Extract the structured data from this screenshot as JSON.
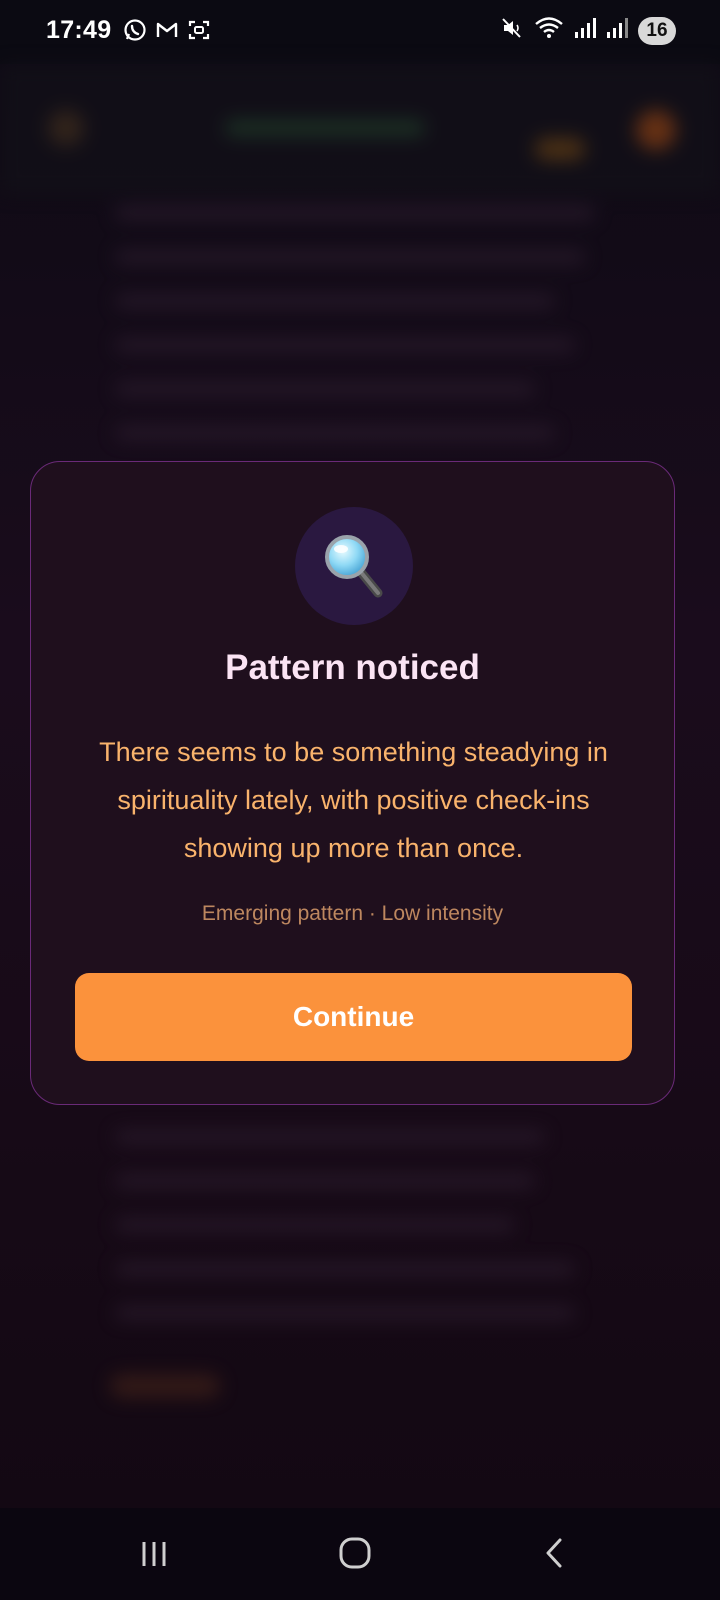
{
  "status_bar": {
    "time": "17:49",
    "left_icons": [
      "whatsapp-icon",
      "gmail-icon",
      "screenshot-icon"
    ],
    "right_icons": [
      "mute-icon",
      "wifi-icon",
      "signal-icon",
      "signal-icon-2"
    ],
    "battery": "16"
  },
  "modal": {
    "icon": "magnifying-glass-icon",
    "title": "Pattern noticed",
    "message": "There seems to be something steadying in spirituality lately, with positive check-ins showing up more than once.",
    "meta": "Emerging pattern · Low intensity",
    "continue_label": "Continue"
  },
  "nav_bar": {
    "buttons": [
      "recent-apps-icon",
      "home-icon",
      "back-icon"
    ]
  },
  "colors": {
    "accent": "#fb923c",
    "title": "#fbe4f4",
    "message": "#f9b36c",
    "meta": "#bd875f",
    "modal_border": "#6a2a78",
    "modal_bg": "#1f0f1d"
  }
}
